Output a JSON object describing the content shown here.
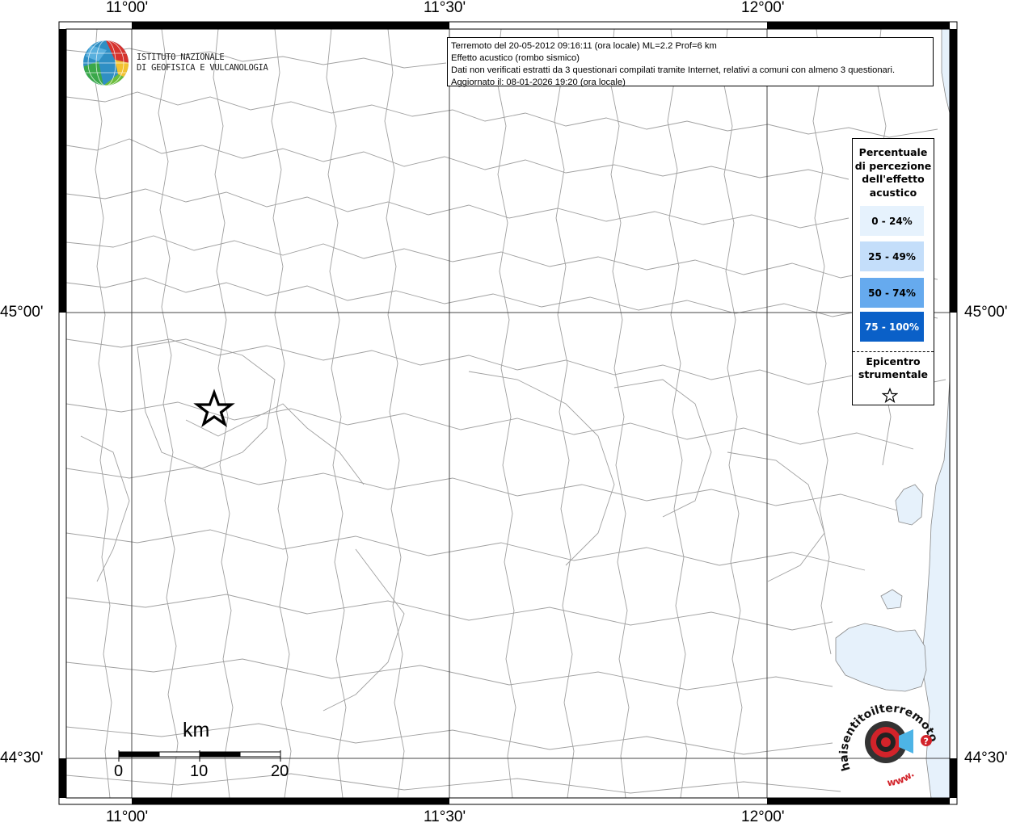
{
  "map": {
    "type": "seismic-acoustic-effect-map",
    "lon_labels": [
      "11°00'",
      "11°30'",
      "12°00'"
    ],
    "lat_labels": [
      "45°00'",
      "44°30'"
    ],
    "colors": {
      "land": "#ffffff",
      "water": "#e6f1fb",
      "boundary": "#9a9a9a",
      "graticule": "#444444",
      "frame": "#000000"
    },
    "epicenter_symbol": "star-outline"
  },
  "info": {
    "line1": "Terremoto del 20-05-2012 09:16:11 (ora locale) ML=2.2 Prof=6 km",
    "line2": "Effetto acustico (rombo sismico)",
    "line3": "Dati non verificati estratti da 3 questionari compilati tramite Internet, relativi a comuni con almeno 3 questionari.",
    "line4": "Aggiornato il: 08-01-2026 19:20 (ora locale)"
  },
  "legend": {
    "title_lines": [
      "Percentuale",
      "di percezione",
      "dell'effetto",
      "acustico"
    ],
    "items": [
      {
        "label": "0 - 24%",
        "color": "#e6f2fd",
        "text_color": "#000000"
      },
      {
        "label": "25 - 49%",
        "color": "#c4defa",
        "text_color": "#000000"
      },
      {
        "label": "50 - 74%",
        "color": "#66aaee",
        "text_color": "#000000"
      },
      {
        "label": "75 - 100%",
        "color": "#0a60c8",
        "text_color": "#ffffff"
      }
    ],
    "epicenter_lines": [
      "Epicentro",
      "strumentale"
    ]
  },
  "logo": {
    "line1": "ISTITUTO NAZIONALE",
    "line2": "DI GEOFISICA E VULCANOLOGIA"
  },
  "scale": {
    "unit": "km",
    "ticks": [
      "0",
      "10",
      "20"
    ]
  },
  "badge": {
    "arc_text": "haisentitoilterremoto.it",
    "url_text": "www.",
    "question_mark": "?"
  }
}
